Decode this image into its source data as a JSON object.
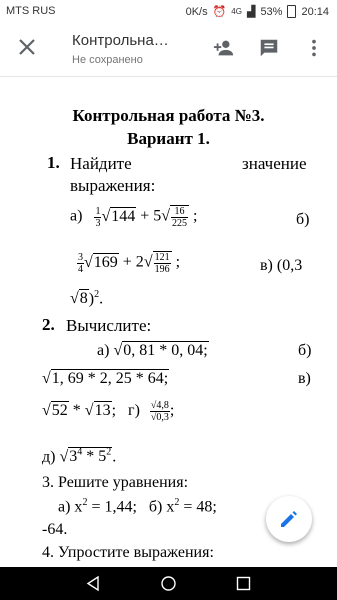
{
  "status": {
    "carrier": "MTS RUS",
    "speed": "0K/s",
    "net": "4G",
    "battery": "53%",
    "time": "20:14"
  },
  "appbar": {
    "title": "Контрольна…",
    "subtitle": "Не сохранено"
  },
  "doc": {
    "title1": "Контрольная работа №3.",
    "title2": "Вариант 1.",
    "l1_num": "1.",
    "l1_a": "Найдите",
    "l1_b": "значение",
    "l1_c": "выражения:",
    "e1_a": "а)",
    "e1_f1n": "1",
    "e1_f1d": "3",
    "e1_s1": "144",
    "e1_plus5": "+ 5",
    "e1_f2n": "16",
    "e1_f2d": "225",
    "e1_semi": ";",
    "e1_b": "б)",
    "e2_f1n": "3",
    "e2_f1d": "4",
    "e2_s1": "169",
    "e2_plus2": "+ 2",
    "e2_f2n": "121",
    "e2_f2d": "196",
    "e2_semi": ";",
    "e2_v": "в) (0,3",
    "e3_s": "8",
    "e3_tail": ")",
    "e3_exp": "2",
    "e3_dot": ".",
    "l2_num": "2.",
    "l2_text": "Вычислите:",
    "e4_a": "а)",
    "e4_s": "0, 81 * 0, 04;",
    "e4_b": "б)",
    "e5_s": "1, 69 * 2, 25 * 64;",
    "e5_v": "в)",
    "e6_s1": "52",
    "e6_mul": "*",
    "e6_s2": "13",
    "e6_semi": ";",
    "e6_g": "г)",
    "e6_fn": "√4,8",
    "e6_fd": "√0,3",
    "e6_semi2": ";",
    "e7_d": "д)",
    "e7_base1": "3",
    "e7_exp1": "4",
    "e7_mul": "* 5",
    "e7_exp2": "2",
    "e7_dot": ".",
    "l3": "3. Решите уравнения:",
    "e8": "а) x",
    "e8_exp": "2",
    "e8_rest": " = 1,44;   б) x",
    "e8_exp2": "2",
    "e8_rest2": " = 48;",
    "e9": "-64.",
    "l4": "4. Упростите выражения:"
  },
  "colors": {
    "fab_icon": "#1a73e8",
    "icon_gray": "#5f6368"
  }
}
